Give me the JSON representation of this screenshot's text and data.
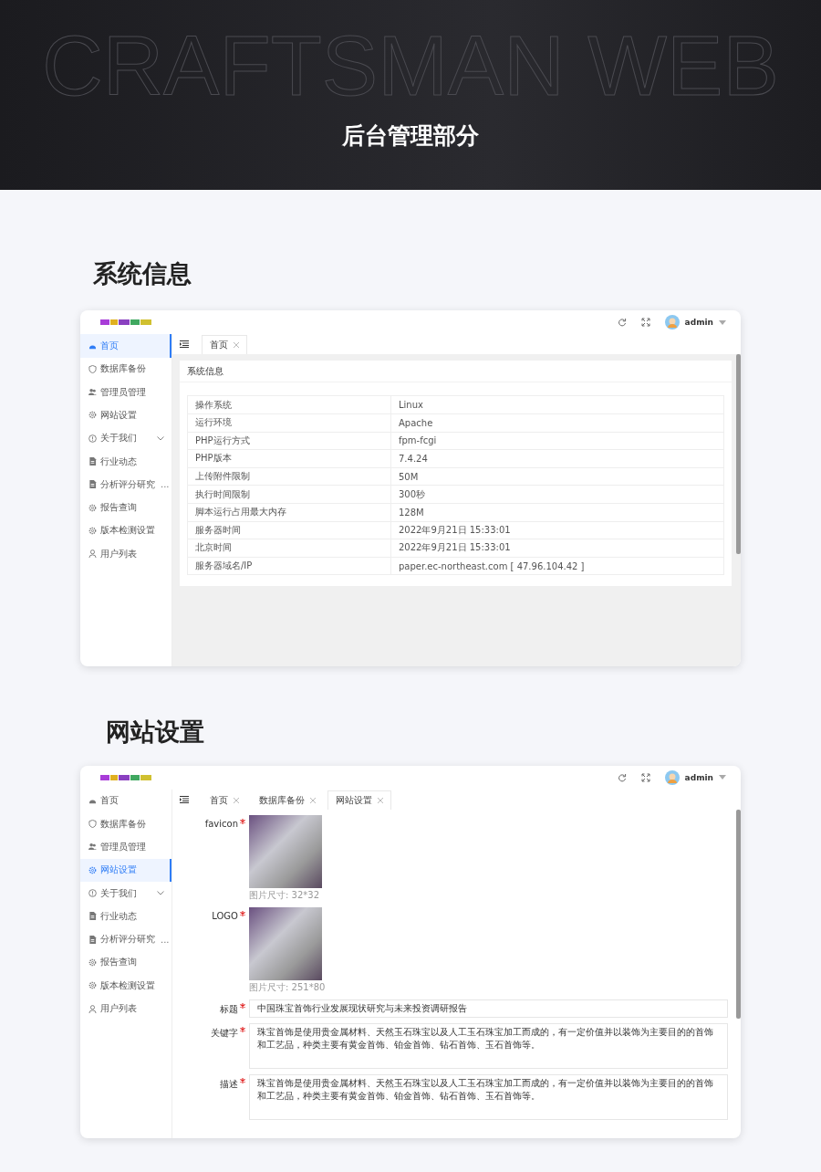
{
  "banner": {
    "background_text": "CRAFTSMAN WEB",
    "title": "后台管理部分"
  },
  "sections": [
    {
      "heading": "系统信息",
      "kind": "system_info",
      "user": "admin",
      "sidebar": [
        {
          "label": "首页",
          "selected": true,
          "has_submenu": false
        },
        {
          "label": "数据库备份",
          "selected": false,
          "has_submenu": false
        },
        {
          "label": "管理员管理",
          "selected": false,
          "has_submenu": false
        },
        {
          "label": "网站设置",
          "selected": false,
          "has_submenu": false
        },
        {
          "label": "关于我们",
          "selected": false,
          "has_submenu": true
        },
        {
          "label": "行业动态",
          "selected": false,
          "has_submenu": false
        },
        {
          "label": "分析评分研究",
          "more": "...",
          "selected": false,
          "has_submenu": false
        },
        {
          "label": "报告查询",
          "selected": false,
          "has_submenu": false
        },
        {
          "label": "版本检测设置",
          "selected": false,
          "has_submenu": false
        },
        {
          "label": "用户列表",
          "selected": false,
          "has_submenu": false
        }
      ],
      "tabs": [
        {
          "label": "首页",
          "selected": true
        }
      ],
      "panel_title": "系统信息",
      "rows": [
        {
          "label": "操作系统",
          "value": "Linux"
        },
        {
          "label": "运行环境",
          "value": "Apache"
        },
        {
          "label": "PHP运行方式",
          "value": "fpm-fcgi"
        },
        {
          "label": "PHP版本",
          "value": "7.4.24"
        },
        {
          "label": "上传附件限制",
          "value": "50M"
        },
        {
          "label": "执行时间限制",
          "value": "300秒"
        },
        {
          "label": "脚本运行占用最大内存",
          "value": "128M"
        },
        {
          "label": "服务器时间",
          "value": "2022年9月21日 15:33:01"
        },
        {
          "label": "北京时间",
          "value": "2022年9月21日 15:33:01"
        },
        {
          "label": "服务器域名/IP",
          "value": "paper.ec-northeast.com [ 47.96.104.42 ]"
        }
      ]
    },
    {
      "heading": "网站设置",
      "kind": "site_settings",
      "user": "admin",
      "sidebar": [
        {
          "label": "首页",
          "selected": false,
          "has_submenu": false
        },
        {
          "label": "数据库备份",
          "selected": false,
          "has_submenu": false
        },
        {
          "label": "管理员管理",
          "selected": false,
          "has_submenu": false
        },
        {
          "label": "网站设置",
          "selected": true,
          "has_submenu": false
        },
        {
          "label": "关于我们",
          "selected": false,
          "has_submenu": true
        },
        {
          "label": "行业动态",
          "selected": false,
          "has_submenu": false
        },
        {
          "label": "分析评分研究",
          "more": "...",
          "selected": false,
          "has_submenu": false
        },
        {
          "label": "报告查询",
          "selected": false,
          "has_submenu": false
        },
        {
          "label": "版本检测设置",
          "selected": false,
          "has_submenu": false
        },
        {
          "label": "用户列表",
          "selected": false,
          "has_submenu": false
        }
      ],
      "tabs": [
        {
          "label": "首页",
          "selected": false
        },
        {
          "label": "数据库备份",
          "selected": false
        },
        {
          "label": "网站设置",
          "selected": true
        }
      ],
      "form": [
        {
          "kind": "image",
          "label": "favicon",
          "required": true,
          "hint": "图片尺寸: 32*32"
        },
        {
          "kind": "image",
          "label": "LOGO",
          "required": true,
          "hint": "图片尺寸: 251*80"
        },
        {
          "kind": "text",
          "label": "标题",
          "required": true,
          "value": "中国珠宝首饰行业发展现状研究与未来投资调研报告"
        },
        {
          "kind": "textarea",
          "label": "关键字",
          "required": true,
          "value": "珠宝首饰是使用贵金属材料、天然玉石珠宝以及人工玉石珠宝加工而成的，有一定价值并以装饰为主要目的的首饰和工艺品，种类主要有黄金首饰、铂金首饰、钻石首饰、玉石首饰等。"
        },
        {
          "kind": "textarea",
          "label": "描述",
          "required": true,
          "value": "珠宝首饰是使用贵金属材料、天然玉石珠宝以及人工玉石珠宝加工而成的，有一定价值并以装饰为主要目的的首饰和工艺品，种类主要有黄金首饰、铂金首饰、钻石首饰、玉石首饰等。"
        }
      ]
    }
  ]
}
